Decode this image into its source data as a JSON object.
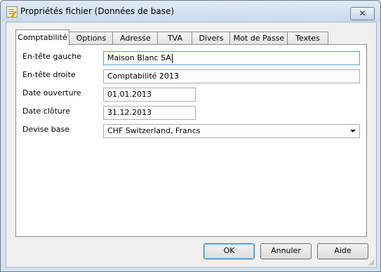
{
  "window": {
    "title": "Propriétés fichier (Données de base)",
    "close_symbol": "✕"
  },
  "tabs": [
    {
      "label": "Comptabilité",
      "active": true
    },
    {
      "label": "Options",
      "active": false
    },
    {
      "label": "Adresse",
      "active": false
    },
    {
      "label": "TVA",
      "active": false
    },
    {
      "label": "Divers",
      "active": false
    },
    {
      "label": "Mot de Passe",
      "active": false
    },
    {
      "label": "Textes",
      "active": false
    }
  ],
  "form": {
    "header_left": {
      "label": "En-tête gauche",
      "value": "Maison Blanc SA"
    },
    "header_right": {
      "label": "En-tête droite",
      "value": "Comptabilité 2013"
    },
    "opening_date": {
      "label": "Date ouverture",
      "value": "01.01.2013"
    },
    "closing_date": {
      "label": "Date clôture",
      "value": "31.12.2013"
    },
    "base_currency": {
      "label": "Devise base",
      "value": "CHF Switzerland, Francs"
    }
  },
  "buttons": {
    "ok": "OK",
    "cancel": "Annuler",
    "help": "Aide"
  }
}
